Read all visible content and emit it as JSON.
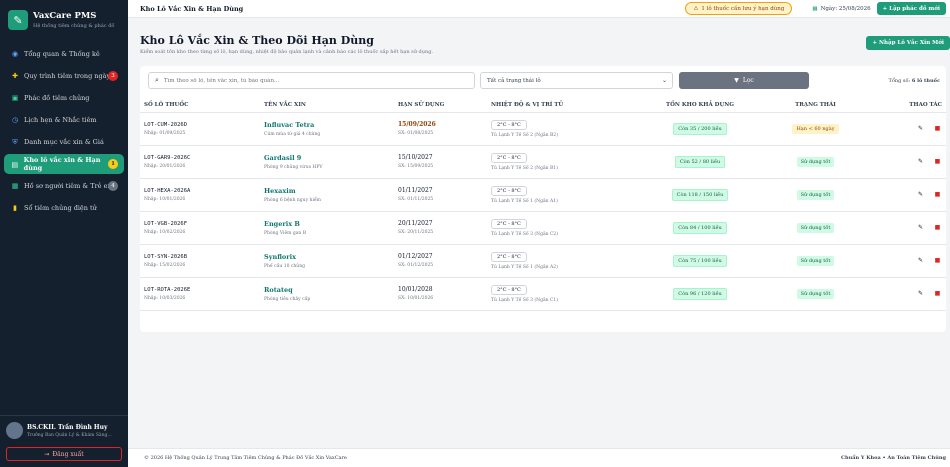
{
  "sidebar": {
    "brand_title": "VaxCare PMS",
    "brand_sub": "Hệ thống tiêm chủng & phác đồ",
    "items": [
      {
        "label": "Tổng quan & Thống kê",
        "icon": "dashboard-icon",
        "badge": ""
      },
      {
        "label": "Quy trình tiêm trong ngày",
        "icon": "syringe-icon",
        "badge": "3"
      },
      {
        "label": "Phác đồ tiêm chủng",
        "icon": "protocol-icon",
        "badge": ""
      },
      {
        "label": "Lịch hẹn & Nhắc tiêm",
        "icon": "clock-icon",
        "badge": ""
      },
      {
        "label": "Danh mục vắc xin & Giá",
        "icon": "shield-icon",
        "badge": ""
      },
      {
        "label": "Kho lô vắc xin & Hạn dùng",
        "icon": "box-icon",
        "badge": "1"
      },
      {
        "label": "Hồ sơ người tiêm & Trẻ em",
        "icon": "users-icon",
        "badge": "4"
      },
      {
        "label": "Sổ tiêm chủng điện tử",
        "icon": "book-icon",
        "badge": ""
      }
    ],
    "user_name": "BS.CKII. Trần Đình Huy",
    "user_role": "Trưởng Ban Quản Lý & Khám Sàng...",
    "logout": "Đăng xuất"
  },
  "topbar": {
    "title": "Kho Lô Vắc Xin & Hạn Dùng",
    "alert": "1 lô thuốc cần lưu ý hạn dùng",
    "date": "Ngày: 25/08/2026",
    "new_button": "+ Lập phác đồ mới"
  },
  "page": {
    "title": "Kho Lô Vắc Xin & Theo Dõi Hạn Dùng",
    "desc": "Kiểm soát tồn kho theo từng số lô, hạn dùng, nhiệt độ bảo quản lạnh và cảnh báo các lô thuốc sắp hết hạn sử dụng.",
    "import_button": "+ Nhập Lô Vắc Xin Mới"
  },
  "filters": {
    "search_placeholder": "Tìm theo số lô, tên vắc xin, tủ bảo quản...",
    "status_select": "Tất cả trạng thái lô",
    "filter_button": "Lọc",
    "total_label": "Tổng số:",
    "total_value": "6 lô thuốc"
  },
  "table": {
    "headers": [
      "SỐ LÔ THUỐC",
      "TÊN VẮC XIN",
      "HẠN SỬ DỤNG",
      "NHIỆT ĐỘ & VỊ TRÍ TỦ",
      "TỒN KHO KHẢ DỤNG",
      "TRẠNG THÁI",
      "THAO TÁC"
    ],
    "rows": [
      {
        "lot": "LOT-CUM-2026D",
        "import": "Nhập: 01/09/2025",
        "name": "Influvac Tetra",
        "desc": "Cúm mùa tứ giá 4 chủng",
        "exp": "15/09/2026",
        "sx": "SX: 01/08/2025",
        "temp": "2°C - 8°C",
        "loc": "Tủ Lạnh Y Tế Số 2 (Ngăn B2)",
        "stock": "Còn 35 / 200 liều",
        "status": "Hạn < 60 ngày",
        "warn": true
      },
      {
        "lot": "LOT-GAR9-2026C",
        "import": "Nhập: 20/01/2026",
        "name": "Gardasil 9",
        "desc": "Phòng 9 chủng virus HPV",
        "exp": "15/10/2027",
        "sx": "SX: 15/09/2025",
        "temp": "2°C - 8°C",
        "loc": "Tủ Lạnh Y Tế Số 2 (Ngăn B1)",
        "stock": "Còn 52 / 80 liều",
        "status": "Sử dụng tốt",
        "warn": false
      },
      {
        "lot": "LOT-HEXA-2026A",
        "import": "Nhập: 10/01/2026",
        "name": "Hexaxim",
        "desc": "Phòng 6 bệnh nguy hiểm",
        "exp": "01/11/2027",
        "sx": "SX: 01/11/2025",
        "temp": "2°C - 8°C",
        "loc": "Tủ Lạnh Y Tế Số 1 (Ngăn A1)",
        "stock": "Còn 118 / 150 liều",
        "status": "Sử dụng tốt",
        "warn": false
      },
      {
        "lot": "LOT-VGB-2026F",
        "import": "Nhập: 10/02/2026",
        "name": "Engerix B",
        "desc": "Phòng Viêm gan B",
        "exp": "20/11/2027",
        "sx": "SX: 20/11/2025",
        "temp": "2°C - 8°C",
        "loc": "Tủ Lạnh Y Tế Số 3 (Ngăn C2)",
        "stock": "Còn 84 / 100 liều",
        "status": "Sử dụng tốt",
        "warn": false
      },
      {
        "lot": "LOT-SYN-2026B",
        "import": "Nhập: 15/02/2026",
        "name": "Synflorix",
        "desc": "Phế cầu 10 chủng",
        "exp": "01/12/2027",
        "sx": "SX: 01/12/2025",
        "temp": "2°C - 8°C",
        "loc": "Tủ Lạnh Y Tế Số 1 (Ngăn A2)",
        "stock": "Còn 75 / 100 liều",
        "status": "Sử dụng tốt",
        "warn": false
      },
      {
        "lot": "LOT-ROTA-2026E",
        "import": "Nhập: 10/03/2026",
        "name": "Rotateq",
        "desc": "Phòng tiêu chảy cấp",
        "exp": "10/01/2028",
        "sx": "SX: 10/01/2026",
        "temp": "2°C - 8°C",
        "loc": "Tủ Lạnh Y Tế Số 3 (Ngăn C1)",
        "stock": "Còn 96 / 120 liều",
        "status": "Sử dụng tốt",
        "warn": false
      }
    ]
  },
  "footer": {
    "left": "© 2026 Hệ Thống Quản Lý Trung Tâm Tiêm Chủng & Phác Đồ Vắc Xin VaxCare",
    "right": "Chuẩn Y Khoa • An Toàn Tiêm Chủng"
  },
  "colors": {
    "accent": "#1f9d7a",
    "sidebar": "#15202e",
    "danger": "#dc2626",
    "warning": "#f59e0b"
  }
}
